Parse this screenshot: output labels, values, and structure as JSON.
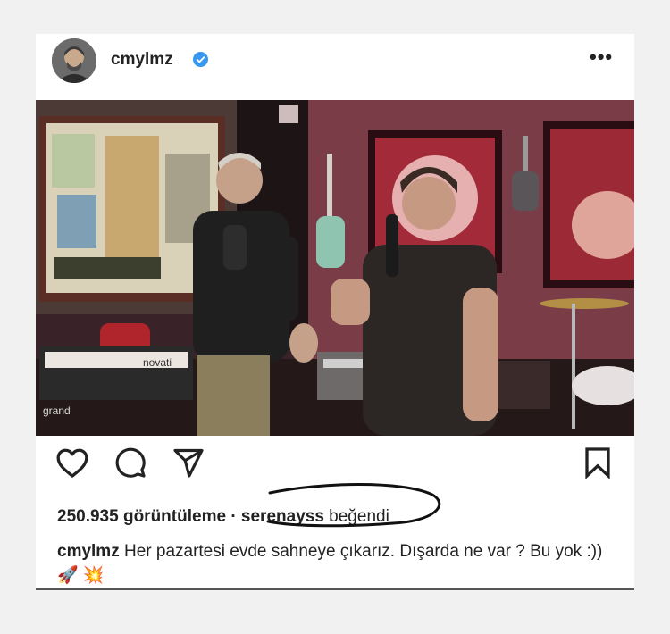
{
  "post": {
    "username": "cmylmz",
    "views_count": "250.935",
    "views_label": "görüntüleme",
    "separator": "·",
    "liked_by_user": "serenayss",
    "liked_label": "beğendi",
    "caption_user": "cmylmz",
    "caption_text": "Her pazartesi evde sahneye çıkarız. Dışarda ne var ? Bu yok :)) 🚀 💥",
    "more_glyph": "•••"
  },
  "media": {
    "keyboard_brand": "novati",
    "keyboard_label": "grand"
  },
  "colors": {
    "verified": "#3897f0",
    "text": "#262626",
    "background": "#f1f1f1"
  }
}
